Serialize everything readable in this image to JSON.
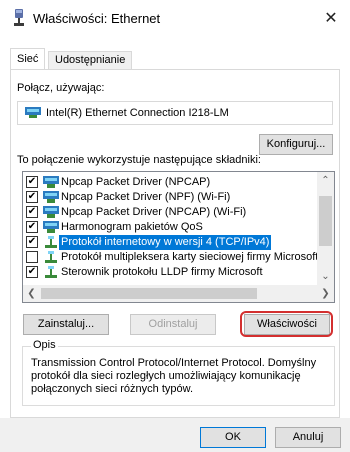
{
  "window": {
    "title": "Właściwości: Ethernet",
    "close_glyph": "✕"
  },
  "tabs": [
    {
      "label": "Sieć",
      "active": true
    },
    {
      "label": "Udostępnianie",
      "active": false
    }
  ],
  "connect": {
    "label": "Połącz, używając:",
    "adapter_name": "Intel(R) Ethernet Connection I218-LM",
    "configure_label": "Konfiguruj..."
  },
  "components": {
    "label": "To połączenie wykorzystuje następujące składniki:",
    "items": [
      {
        "label": "Npcap Packet Driver (NPCAP)",
        "checked": true,
        "icon": "network-adapter-icon"
      },
      {
        "label": "Npcap Packet Driver (NPF) (Wi-Fi)",
        "checked": true,
        "icon": "network-adapter-icon"
      },
      {
        "label": "Npcap Packet Driver (NPCAP) (Wi-Fi)",
        "checked": true,
        "icon": "network-adapter-icon"
      },
      {
        "label": "Harmonogram pakietów QoS",
        "checked": true,
        "icon": "network-adapter-icon"
      },
      {
        "label": "Protokół internetowy w wersji 4 (TCP/IPv4)",
        "checked": true,
        "icon": "protocol-icon",
        "selected": true
      },
      {
        "label": "Protokół multipleksera karty sieciowej firmy Microsoft",
        "checked": false,
        "icon": "protocol-icon"
      },
      {
        "label": "Sterownik protokołu LLDP firmy Microsoft",
        "checked": true,
        "icon": "protocol-icon"
      }
    ]
  },
  "buttons": {
    "install": "Zainstaluj...",
    "uninstall": "Odinstaluj",
    "properties": "Właściwości",
    "ok": "OK",
    "cancel": "Anuluj"
  },
  "description": {
    "legend": "Opis",
    "text": "Transmission Control Protocol/Internet Protocol. Domyślny protokół dla sieci rozległych umożliwiający komunikację połączonych sieci różnych typów."
  },
  "colors": {
    "selection": "#0078d7",
    "highlight_ring": "#d32f2f"
  }
}
